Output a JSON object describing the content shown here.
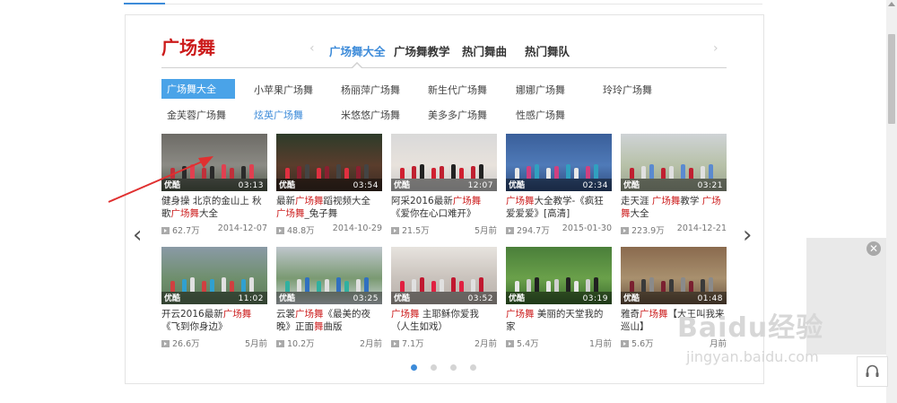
{
  "section_title": "广场舞",
  "tabs": [
    "广场舞大全",
    "广场舞教学",
    "热门舞曲",
    "热门舞队"
  ],
  "categories_row1": [
    "广场舞大全",
    "小苹果广场舞",
    "杨丽萍广场舞",
    "新生代广场舞",
    "娜娜广场舞",
    "玲玲广场舞"
  ],
  "categories_row2": [
    "金芙蓉广场舞",
    "炫英广场舞",
    "米悠悠广场舞",
    "美多多广场舞",
    "性感广场舞"
  ],
  "videos_row1": [
    {
      "pre": "健身操 北京的金山上 秋歌",
      "kw": "广场舞",
      "post": "大全",
      "views": "62.7万",
      "date": "2014-12-07",
      "duration": "03:13",
      "logo": "优酷"
    },
    {
      "pre": "最新",
      "kw": "广场舞",
      "post": "蹈视频大全 ",
      "kw2": "广场舞",
      "post2": "_兔子舞",
      "views": "48.8万",
      "date": "2014-10-29",
      "duration": "03:54",
      "logo": "优酷"
    },
    {
      "pre": "阿采2016最新",
      "kw": "广场舞",
      "post": "《爱你在心口难开》",
      "views": "21.5万",
      "date": "5月前",
      "duration": "12:07",
      "logo": "优酷"
    },
    {
      "pre": "",
      "kw": "广场舞",
      "post": "大全教学-《疯狂爱爱爱》[高清]",
      "views": "294.7万",
      "date": "2015-01-30",
      "duration": "02:34",
      "logo": "优酷"
    },
    {
      "pre": "走天涯 ",
      "kw": "广场舞",
      "post": "教学 ",
      "kw2": "广场舞",
      "post2": "大全",
      "views": "223.9万",
      "date": "2014-12-21",
      "duration": "03:21",
      "logo": "优酷"
    }
  ],
  "videos_row2": [
    {
      "pre": "开云2016最新",
      "kw": "广场舞",
      "post": "《飞到你身边》",
      "views": "26.6万",
      "date": "5月前",
      "duration": "11:02",
      "logo": "优酷"
    },
    {
      "pre": "云裳",
      "kw": "广场舞",
      "post": "《最美的夜晚》正面",
      "kw2": "舞",
      "post2": "曲版",
      "views": "10.2万",
      "date": "2月前",
      "duration": "03:25",
      "logo": "优酷"
    },
    {
      "pre": "",
      "kw": "广场舞",
      "post": " 主耶稣你爱我（人生如戏）",
      "views": "7.1万",
      "date": "2月前",
      "duration": "03:52",
      "logo": "优酷"
    },
    {
      "pre": "",
      "kw": "广场舞",
      "post": " 美丽的天堂我的家",
      "views": "5.4万",
      "date": "1月前",
      "duration": "03:19",
      "logo": "优酷"
    },
    {
      "pre": "雅奇",
      "kw": "广场舞",
      "post": "【大王叫我来巡山】",
      "views": "5.6万",
      "date": "月前",
      "duration": "01:48",
      "logo": "优酷"
    }
  ],
  "watermark": {
    "main": "Baidu经验",
    "sub": "jingyan.baidu.com"
  },
  "colors": {
    "accent": "#3d8bd9",
    "keyword": "#cc1b1b",
    "selected_bg": "#4aa3e8"
  }
}
